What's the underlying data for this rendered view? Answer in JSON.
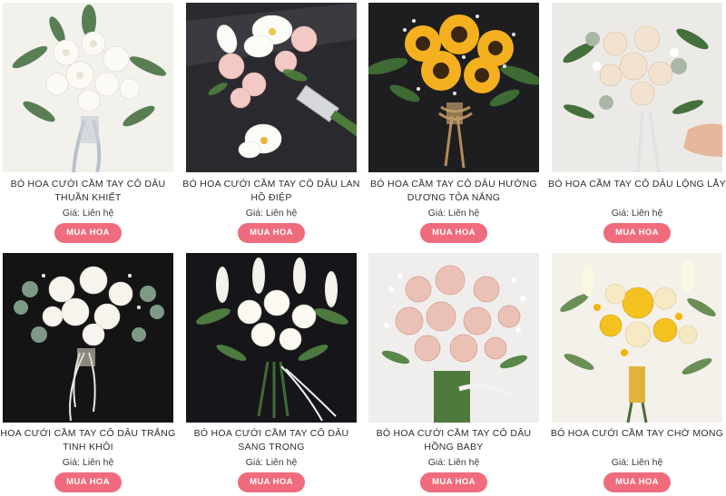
{
  "products": [
    {
      "name": "BÓ HOA CƯỚI CẦM TAY CÔ DÂU THUẦN KHIẾT",
      "price": "Giá: Liên hệ",
      "button": "MUA HOA",
      "image": "white-bouquet-photo"
    },
    {
      "name": "BÓ HOA CƯỚI CẦM TAY CÔ DÂU LAN HỒ ĐIỆP",
      "price": "Giá: Liên hệ",
      "button": "MUA HOA",
      "image": "orchid-bouquet-photo"
    },
    {
      "name": "BÓ HOA CẦM TAY CÔ DÂU HƯỚNG DƯƠNG TỎA NẮNG",
      "price": "Giá: Liên hệ",
      "button": "MUA HOA",
      "image": "sunflower-bouquet-photo"
    },
    {
      "name": "BÓ HOA CẦM TAY CÔ DÂU LỘNG LẪY",
      "price": "Giá: Liên hệ",
      "button": "MUA HOA",
      "image": "peach-rose-bouquet-photo"
    },
    {
      "name": "HOA CƯỚI CẦM TAY CÔ DÂU TRẮNG TINH KHÔI",
      "price": "Giá: Liên hệ",
      "button": "MUA HOA",
      "image": "white-eucalyptus-bouquet-photo"
    },
    {
      "name": "BÓ HOA CƯỚI CẦM TAY CÔ DÂU SANG TRỌNG",
      "price": "Giá: Liên hệ",
      "button": "MUA HOA",
      "image": "snapdragon-bouquet-photo"
    },
    {
      "name": "BÓ HOA CƯỚI CẦM TAY CÔ DÂU HỒNG BABY",
      "price": "Giá: Liên hệ",
      "button": "MUA HOA",
      "image": "pink-rose-bouquet-photo"
    },
    {
      "name": "BÓ HOA CƯỚI CẦM TAY CHỜ MONG",
      "price": "Giá: Liên hệ",
      "button": "MUA HOA",
      "image": "yellow-rose-bouquet-photo"
    }
  ],
  "colors": {
    "button_bg": "#f06b7b",
    "button_text": "#ffffff",
    "title_text": "#2d2d2d"
  }
}
